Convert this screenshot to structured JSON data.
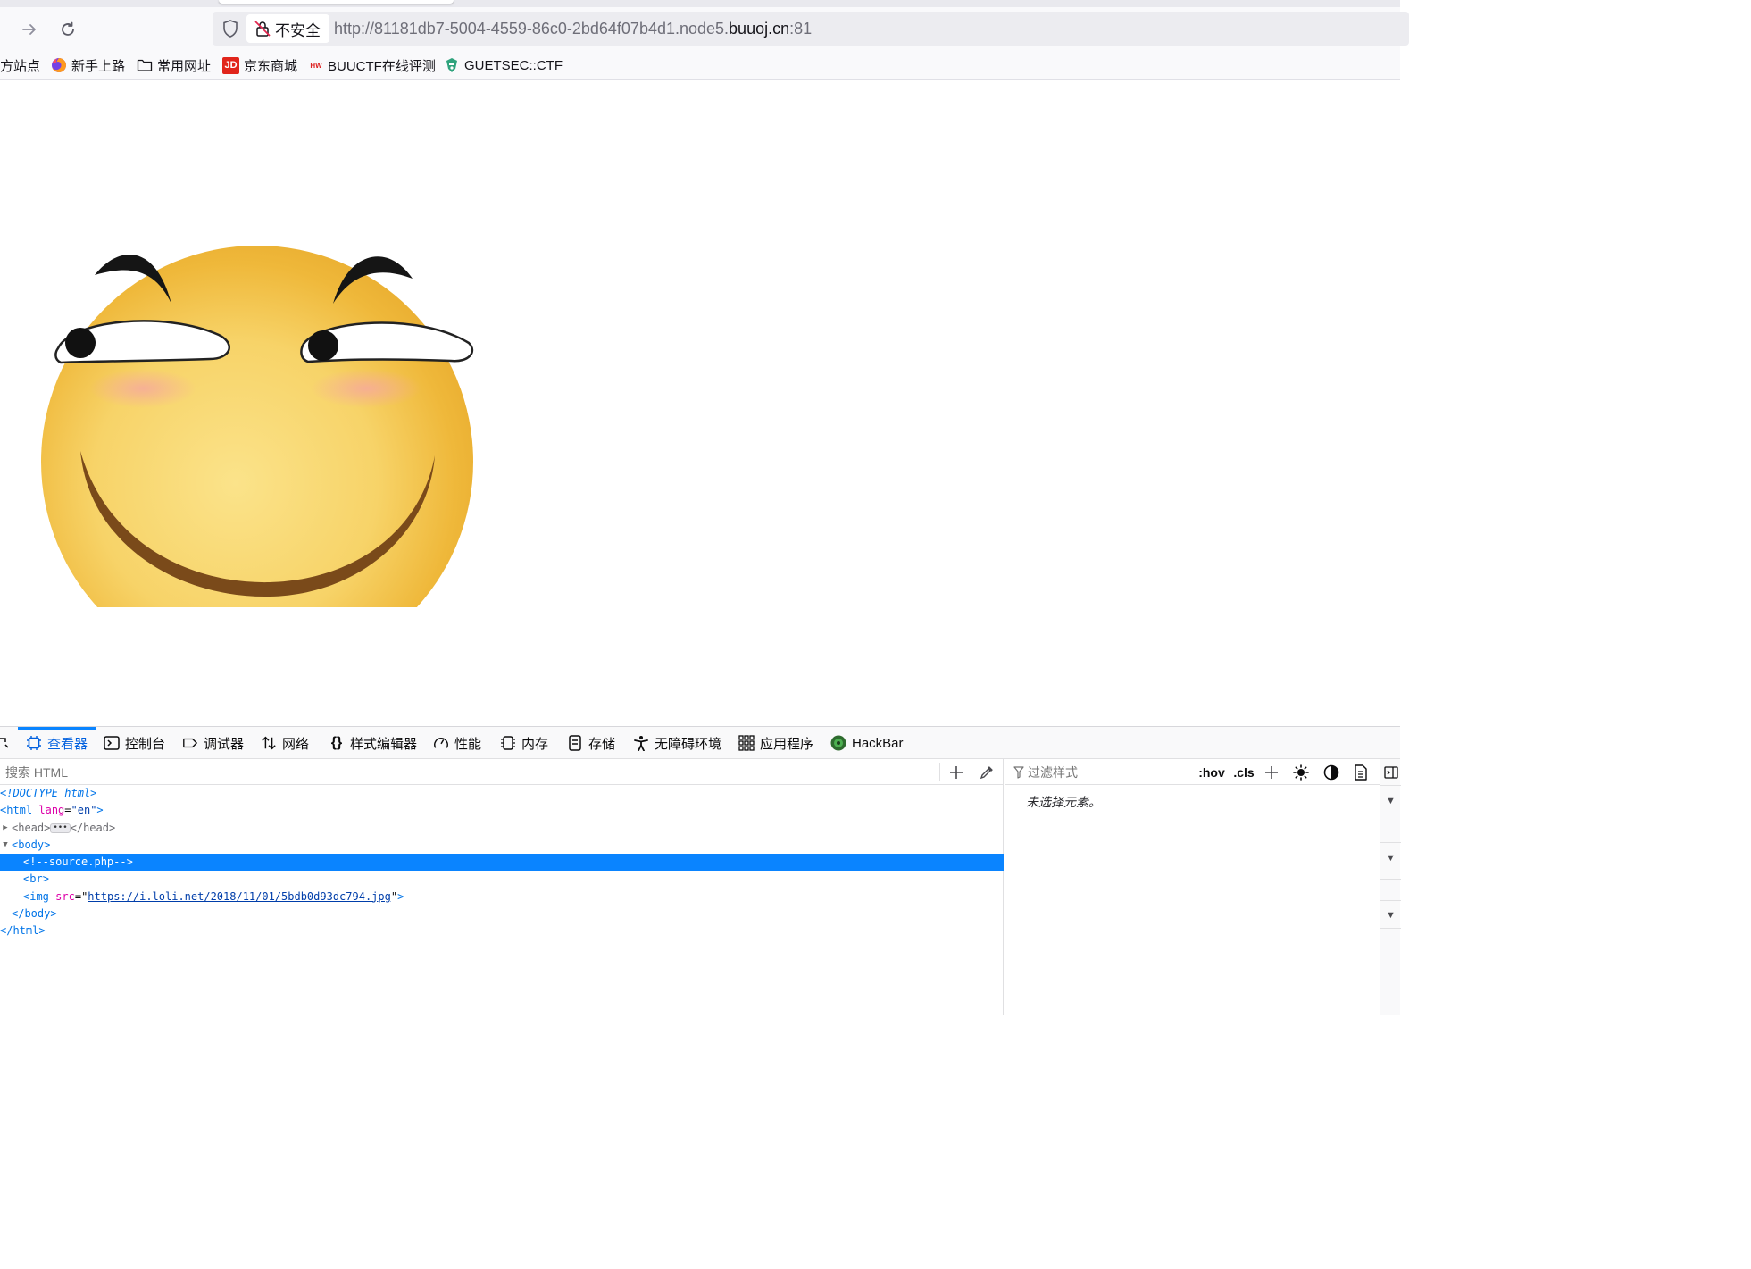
{
  "browser": {
    "url_security_label": "不安全",
    "url_prefix": "http://81181db7-5004-4559-86c0-2bd64f07b4d1.node5.",
    "url_domain": "buuoj.cn",
    "url_suffix": ":81"
  },
  "bookmarks": [
    {
      "label": "方站点",
      "icon": "none"
    },
    {
      "label": "新手上路",
      "icon": "firefox-icon"
    },
    {
      "label": "常用网址",
      "icon": "folder-icon"
    },
    {
      "label": "京东商城",
      "icon": "jd-icon"
    },
    {
      "label": "BUUCTF在线评测",
      "icon": "buuctf-icon"
    },
    {
      "label": "GUETSEC::CTF",
      "icon": "guetsec-icon"
    }
  ],
  "devtools": {
    "tabs": [
      {
        "label": "查看器",
        "icon": "inspector-icon",
        "active": true
      },
      {
        "label": "控制台",
        "icon": "console-icon"
      },
      {
        "label": "调试器",
        "icon": "debugger-icon"
      },
      {
        "label": "网络",
        "icon": "network-icon"
      },
      {
        "label": "样式编辑器",
        "icon": "style-editor-icon"
      },
      {
        "label": "性能",
        "icon": "performance-icon"
      },
      {
        "label": "内存",
        "icon": "memory-icon"
      },
      {
        "label": "存储",
        "icon": "storage-icon"
      },
      {
        "label": "无障碍环境",
        "icon": "accessibility-icon"
      },
      {
        "label": "应用程序",
        "icon": "application-icon"
      },
      {
        "label": "HackBar",
        "icon": "hackbar-icon"
      }
    ],
    "search_placeholder": "搜索 HTML",
    "filter_placeholder": "过滤样式",
    "hov_label": ":hov",
    "cls_label": ".cls",
    "no_element_text": "未选择元素。",
    "markup": {
      "doctype": "<!DOCTYPE html>",
      "html_tag": "html",
      "html_attr": "lang",
      "html_attr_value": "\"en\"",
      "head_open": "<head>",
      "head_close": "</head>",
      "body_tag": "body",
      "comment": "<!--source.php-->",
      "br_tag": "br",
      "img_tag": "img",
      "img_attr": "src",
      "img_src": "https://i.loli.net/2018/11/01/5bdb0d93dc794.jpg"
    }
  },
  "colors": {
    "accent": "#0a84ff",
    "active_tab_text": "#0060df",
    "smiley_face": "#f6c744",
    "smiley_mouth": "#7a4a1a"
  }
}
